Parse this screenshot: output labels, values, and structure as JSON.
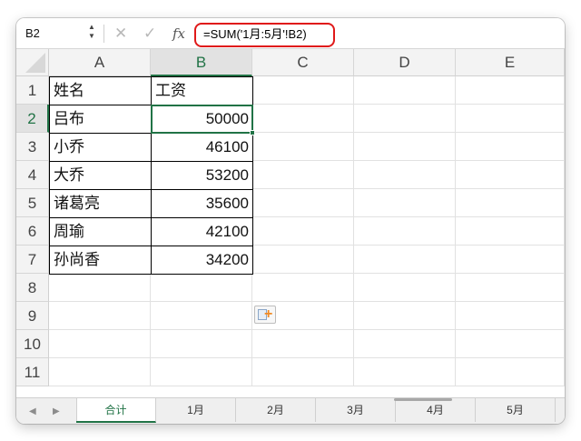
{
  "formula_bar": {
    "name_box": "B2",
    "cancel_icon": "✕",
    "enter_icon": "✓",
    "fx_label": "fx",
    "formula": "=SUM('1月:5月'!B2)"
  },
  "columns": [
    "A",
    "B",
    "C",
    "D",
    "E"
  ],
  "selected_column": "B",
  "rows": [
    "1",
    "2",
    "3",
    "4",
    "5",
    "6",
    "7",
    "8",
    "9",
    "10",
    "11"
  ],
  "selected_row": "2",
  "table": {
    "headers": [
      "姓名",
      "工资"
    ],
    "records": [
      {
        "name": "吕布",
        "salary": "50000"
      },
      {
        "name": "小乔",
        "salary": "46100"
      },
      {
        "name": "大乔",
        "salary": "53200"
      },
      {
        "name": "诸葛亮",
        "salary": "35600"
      },
      {
        "name": "周瑜",
        "salary": "42100"
      },
      {
        "name": "孙尚香",
        "salary": "34200"
      }
    ]
  },
  "sheet_tabs": [
    "合计",
    "1月",
    "2月",
    "3月",
    "4月",
    "5月"
  ],
  "active_tab": "合计",
  "icons": {
    "name_box_stepper": "chevron-updown-icon",
    "cancel": "close-icon",
    "enter": "check-icon",
    "function": "fx-icon",
    "paste_options": "paste-options-icon",
    "tab_prev": "triangle-left-icon",
    "tab_next": "triangle-right-icon"
  },
  "colors": {
    "selection": "#217346",
    "highlight": "#e01919",
    "paste_plus": "#f08a24"
  }
}
